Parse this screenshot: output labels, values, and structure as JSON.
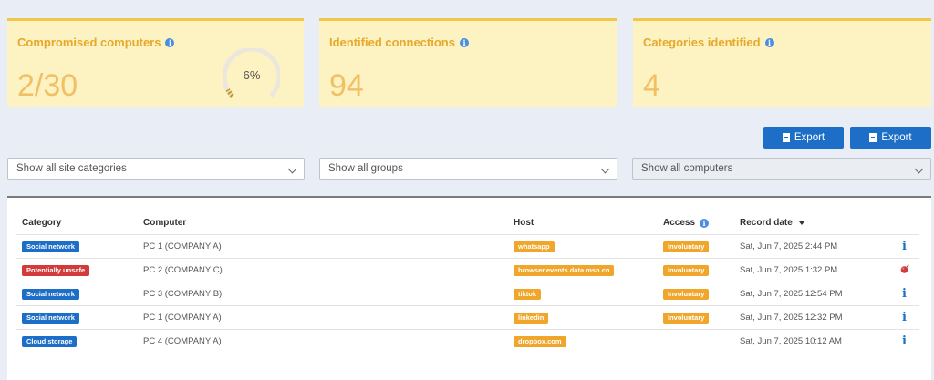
{
  "cards": [
    {
      "title": "Compromised computers",
      "value": "2/30",
      "gauge_percent_label": "6%",
      "gauge_fraction": 0.06
    },
    {
      "title": "Identified connections",
      "value": "94"
    },
    {
      "title": "Categories identified",
      "value": "4"
    }
  ],
  "buttons": {
    "export_1": "Export",
    "export_2": "Export"
  },
  "filters": {
    "site_categories": "Show all site categories",
    "groups": "Show all groups",
    "computers": "Show all computers"
  },
  "table": {
    "headers": {
      "category": "Category",
      "computer": "Computer",
      "host": "Host",
      "access": "Access",
      "record_date": "Record date"
    },
    "rows": [
      {
        "category": "Social network",
        "category_color": "#1c6ec6",
        "computer": "PC 1 (COMPANY A)",
        "host": "whatsapp",
        "access": "Involuntary",
        "date": "Sat, Jun 7, 2025 2:44 PM",
        "action_icon": "info-icon"
      },
      {
        "category": "Potentially unsafe",
        "category_color": "#d33b3b",
        "computer": "PC 2 (COMPANY C)",
        "host": "browser.events.data.msn.cn",
        "access": "Involuntary",
        "date": "Sat, Jun 7, 2025 1:32 PM",
        "action_icon": "bomb-icon"
      },
      {
        "category": "Social network",
        "category_color": "#1c6ec6",
        "computer": "PC 3 (COMPANY B)",
        "host": "tiktok",
        "access": "Involuntary",
        "date": "Sat, Jun 7, 2025 12:54 PM",
        "action_icon": "info-icon"
      },
      {
        "category": "Social network",
        "category_color": "#1c6ec6",
        "computer": "PC 1 (COMPANY A)",
        "host": "linkedin",
        "access": "Involuntary",
        "date": "Sat, Jun 7, 2025 12:32 PM",
        "action_icon": "info-icon"
      },
      {
        "category": "Cloud storage",
        "category_color": "#1c6ec6",
        "computer": "PC 4 (COMPANY A)",
        "host": "dropbox.com",
        "access": "",
        "date": "Sat, Jun 7, 2025 10:12 AM",
        "action_icon": "info-icon"
      }
    ]
  },
  "colors": {
    "accent": "#1c6ec6",
    "card_bg": "#fdf2c2",
    "card_value": "#f2c064",
    "badge_orange": "#f0a62a",
    "badge_red": "#d33b3b"
  }
}
